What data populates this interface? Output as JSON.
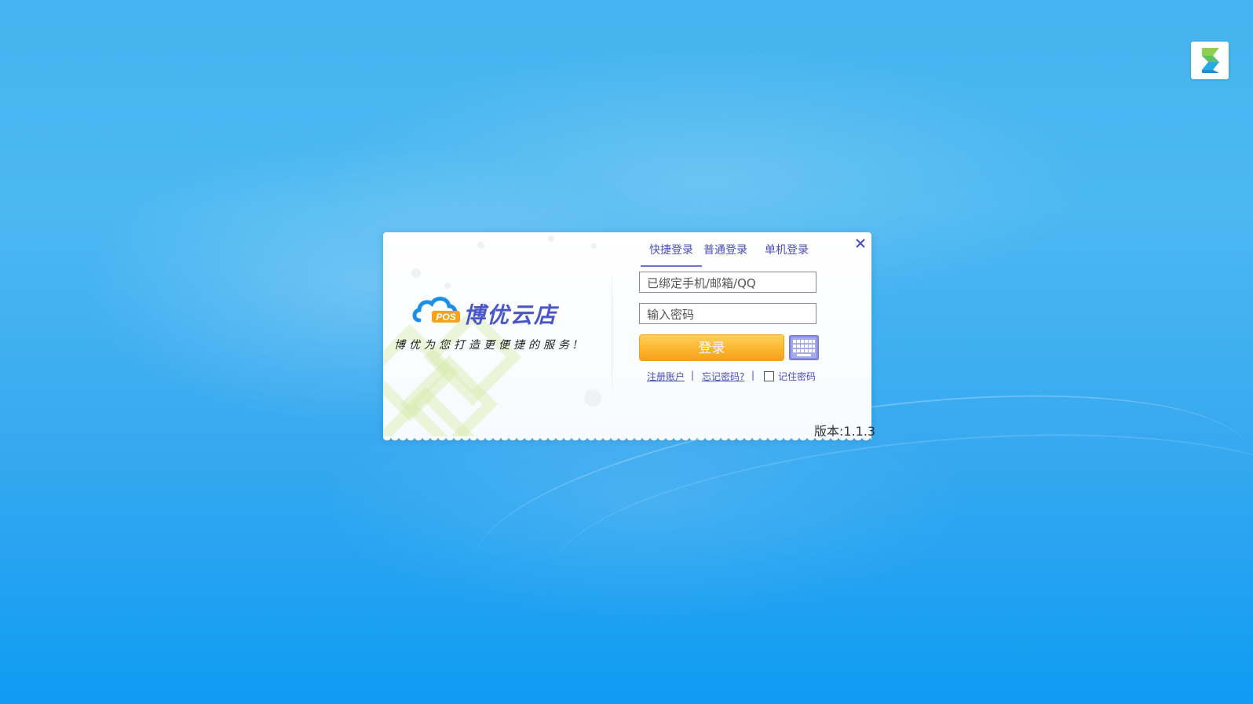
{
  "app": {
    "corner_icon": "app-logo-icon"
  },
  "dialog": {
    "brand": {
      "logo_icon": "cloud-pos-logo-icon",
      "logo_text": "POS",
      "name": "博优云店",
      "slogan": "博优为您打造更便捷的服务!"
    },
    "tabs": [
      {
        "label": "快捷登录",
        "active": true
      },
      {
        "label": "普通登录",
        "active": false
      },
      {
        "label": "单机登录",
        "active": false
      }
    ],
    "account_input": {
      "placeholder": "已绑定手机/邮箱/QQ",
      "value": ""
    },
    "password_input": {
      "placeholder": "输入密码",
      "value": ""
    },
    "login_button": "登录",
    "keyboard_icon": "virtual-keyboard-icon",
    "links": {
      "register": "注册账户",
      "forgot": "忘记密码?",
      "separator": "|"
    },
    "remember_password": {
      "label": "记住密码",
      "checked": false
    },
    "version": "版本:1.1.3",
    "close_icon": "close-icon"
  },
  "colors": {
    "accent": "#4a4fb8",
    "login_button": "#fbb530",
    "background": "#3aaaf0"
  }
}
